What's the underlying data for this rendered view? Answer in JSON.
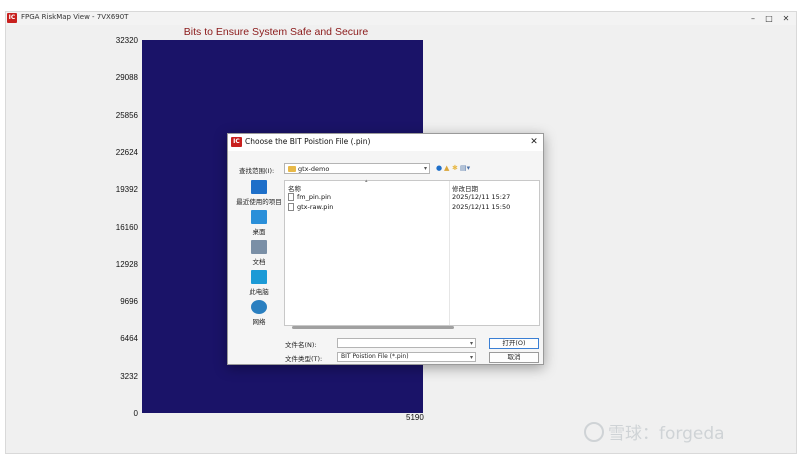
{
  "window": {
    "logo_text": "IC",
    "title": "FPGA RiskMap View - 7VX690T",
    "controls": [
      "–",
      "□",
      "✕"
    ]
  },
  "chart_data": {
    "type": "heatmap",
    "title": "Bits to Ensure System Safe and Secure",
    "yticks": [
      "32320",
      "29088",
      "25856",
      "22624",
      "19392",
      "16160",
      "12928",
      "9696",
      "6464",
      "3232",
      "0"
    ],
    "xticks": [
      "5190"
    ],
    "ylim": [
      0,
      32320
    ],
    "xlim": [
      0,
      5190
    ],
    "fill_color": "#1a1368"
  },
  "dialog": {
    "logo_text": "IC",
    "title": "Choose the BIT Poistion File (.pin)",
    "close": "✕",
    "lookin_label": "查找范围(I):",
    "lookin_value": "gtx-demo",
    "toolbar_icons": [
      "back-icon",
      "up-folder-icon",
      "new-folder-icon",
      "view-menu-icon"
    ],
    "places": [
      {
        "label": "最近使用的项目",
        "icon": "recent-icon",
        "color": "#1e6fc9"
      },
      {
        "label": "桌面",
        "icon": "desktop-icon",
        "color": "#2a8fd9"
      },
      {
        "label": "文档",
        "icon": "documents-icon",
        "color": "#7a8fa6"
      },
      {
        "label": "此电脑",
        "icon": "computer-icon",
        "color": "#1c9ad6"
      },
      {
        "label": "网络",
        "icon": "network-icon",
        "color": "#2a7fc0"
      }
    ],
    "columns": {
      "name": "名称",
      "date": "修改日期"
    },
    "files": [
      {
        "name": "fm_pin.pin",
        "date": "2025/12/11 15:27"
      },
      {
        "name": "gtx-raw.pin",
        "date": "2025/12/11 15:50"
      }
    ],
    "filename_label": "文件名(N):",
    "filename_value": "",
    "filetype_label": "文件类型(T):",
    "filetype_value": "BIT Poistion File (*.pin)",
    "open_button": "打开(O)",
    "cancel_button": "取消"
  },
  "watermark": "雪球：forgeda"
}
